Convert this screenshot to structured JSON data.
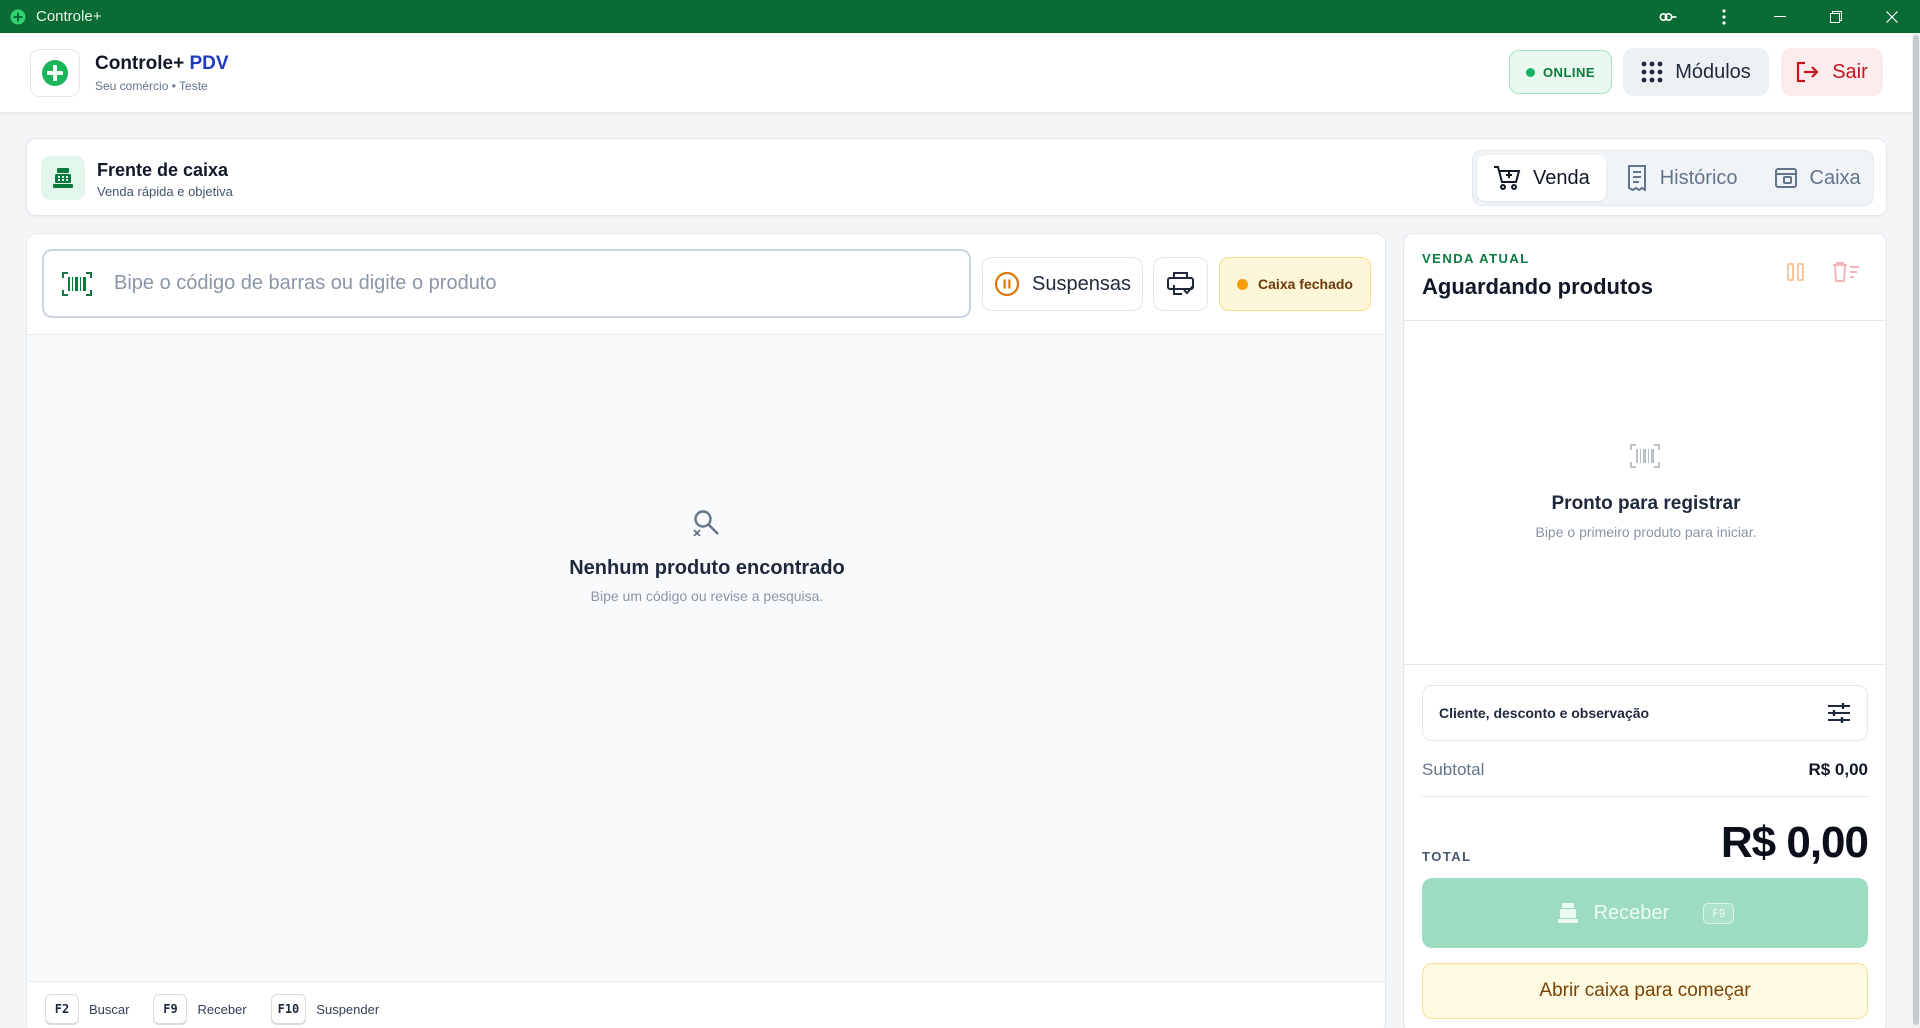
{
  "window": {
    "title": "Controle+"
  },
  "header": {
    "brand_name": "Controle+",
    "brand_suffix": "PDV",
    "brand_subtitle": "Seu comércio • Teste",
    "status_label": "ONLINE",
    "modules_label": "Módulos",
    "exit_label": "Sair"
  },
  "section": {
    "title": "Frente de caixa",
    "subtitle": "Venda rápida e objetiva",
    "tabs": [
      {
        "label": "Venda",
        "icon": "cart-icon",
        "active": true
      },
      {
        "label": "Histórico",
        "icon": "receipt-icon",
        "active": false
      },
      {
        "label": "Caixa",
        "icon": "cash-drawer-icon",
        "active": false
      }
    ]
  },
  "search": {
    "placeholder": "Bipe o código de barras ou digite o produto",
    "value": ""
  },
  "toolbar": {
    "suspended_label": "Suspensas",
    "cash_status_label": "Caixa fechado"
  },
  "products": {
    "empty_title": "Nenhum produto encontrado",
    "empty_subtitle": "Bipe um código ou revise a pesquisa."
  },
  "shortcuts": [
    {
      "key": "F2",
      "label": "Buscar"
    },
    {
      "key": "F9",
      "label": "Receber"
    },
    {
      "key": "F10",
      "label": "Suspender"
    }
  ],
  "sale": {
    "kicker": "VENDA ATUAL",
    "title": "Aguardando produtos",
    "ready_title": "Pronto para registrar",
    "ready_subtitle": "Bipe o primeiro produto para iniciar.",
    "options_label": "Cliente, desconto e observação",
    "subtotal_label": "Subtotal",
    "subtotal_value": "R$ 0,00",
    "total_label": "TOTAL",
    "total_value": "R$ 0,00",
    "receive_label": "Receber",
    "receive_key": "F9",
    "open_cash_label": "Abrir caixa para começar"
  },
  "colors": {
    "titlebar": "#0b6b34",
    "accent_green": "#0b7a3e",
    "pdv_blue": "#1d3bbf",
    "danger": "#c4161c",
    "warning": "#f59e0b"
  }
}
